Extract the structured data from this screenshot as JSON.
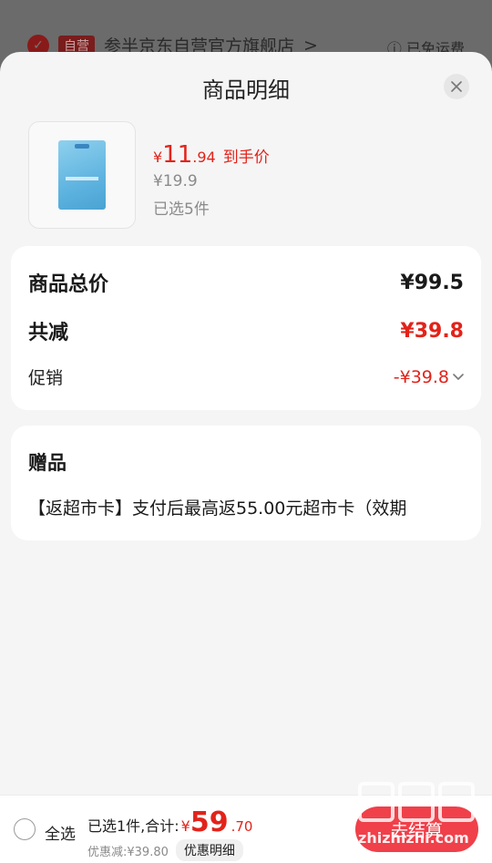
{
  "background": {
    "shop_badge": "自营",
    "shop_name": "参半京东自营官方旗舰店",
    "shop_chevron": ">",
    "shipping": "ⓘ 已免运费"
  },
  "sheet": {
    "title": "商品明细",
    "close_icon": "close-icon"
  },
  "product": {
    "price_symbol": "¥",
    "price_int": "11",
    "price_dec": ".94",
    "price_tag": "到手价",
    "original_price": "¥19.9",
    "selected": "已选5件"
  },
  "summary": {
    "total_label": "商品总价",
    "total_value": "¥99.5",
    "reduce_label": "共减",
    "reduce_value": "¥39.8",
    "promo_label": "促销",
    "promo_value": "-¥39.8"
  },
  "gift": {
    "title": "赠品",
    "text": "【返超市卡】支付后最高返55.00元超市卡（效期"
  },
  "bottom": {
    "select_all": "全选",
    "sum_label": "已选1件,合计:",
    "sum_yen": "¥",
    "sum_int": "59",
    "sum_dec": ".70",
    "discount": "优惠减:¥39.80",
    "detail_chip": "优惠明细",
    "checkout": "去结算"
  },
  "watermark": {
    "url": "zhizhizhi.com"
  },
  "colors": {
    "accent_red": "#e2231a",
    "checkout_red": "#f0404a",
    "sheet_bg": "#f5f5f5"
  }
}
